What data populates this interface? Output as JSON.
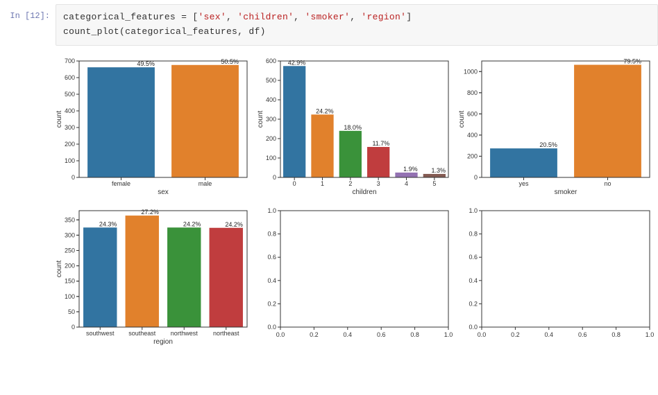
{
  "cell": {
    "prompt_label": "In [12]:",
    "code_name": "categorical_features",
    "code_assign": " = [",
    "code_str1": "'sex'",
    "code_sep": ", ",
    "code_str2": "'children'",
    "code_str3": "'smoker'",
    "code_str4": "'region'",
    "code_close": "]",
    "code_line2_fn": "count_plot",
    "code_line2_open": "(",
    "code_line2_arg1": "categorical_features",
    "code_line2_arg2": "df",
    "code_line2_close": ")"
  },
  "palette": [
    "#3274A1",
    "#E1812C",
    "#3A923A",
    "#C03D3E",
    "#9372B2",
    "#845B53"
  ],
  "chart_data": [
    {
      "type": "bar",
      "id": "sex",
      "xlabel": "sex",
      "ylabel": "count",
      "categories": [
        "female",
        "male"
      ],
      "values": [
        662,
        676
      ],
      "annotations": [
        "49.5%",
        "50.5%"
      ],
      "ylim": [
        0,
        700
      ],
      "yticks": [
        0,
        100,
        200,
        300,
        400,
        500,
        600,
        700
      ]
    },
    {
      "type": "bar",
      "id": "children",
      "xlabel": "children",
      "ylabel": "count",
      "categories": [
        "0",
        "1",
        "2",
        "3",
        "4",
        "5"
      ],
      "values": [
        574,
        324,
        240,
        157,
        25,
        18
      ],
      "annotations": [
        "42.9%",
        "24.2%",
        "18.0%",
        "11.7%",
        "1.9%",
        "1.3%"
      ],
      "ylim": [
        0,
        600
      ],
      "yticks": [
        0,
        100,
        200,
        300,
        400,
        500,
        600
      ]
    },
    {
      "type": "bar",
      "id": "smoker",
      "xlabel": "smoker",
      "ylabel": "count",
      "categories": [
        "yes",
        "no"
      ],
      "values": [
        274,
        1064
      ],
      "annotations": [
        "20.5%",
        "79.5%"
      ],
      "ylim": [
        0,
        1100
      ],
      "yticks": [
        0,
        200,
        400,
        600,
        800,
        1000
      ]
    },
    {
      "type": "bar",
      "id": "region",
      "xlabel": "region",
      "ylabel": "count",
      "categories": [
        "southwest",
        "southeast",
        "northwest",
        "northeast"
      ],
      "values": [
        325,
        364,
        325,
        324
      ],
      "annotations": [
        "24.3%",
        "27.2%",
        "24.2%",
        "24.2%"
      ],
      "ylim": [
        0,
        380
      ],
      "yticks": [
        0,
        50,
        100,
        150,
        200,
        250,
        300,
        350
      ]
    },
    {
      "type": "empty",
      "id": "empty1",
      "xlabel": "",
      "ylabel": "",
      "xticks": [
        0.0,
        0.2,
        0.4,
        0.6,
        0.8,
        1.0
      ],
      "yticks": [
        0.0,
        0.2,
        0.4,
        0.6,
        0.8,
        1.0
      ],
      "xlim": [
        0.0,
        1.0
      ],
      "ylim": [
        0.0,
        1.0
      ]
    },
    {
      "type": "empty",
      "id": "empty2",
      "xlabel": "",
      "ylabel": "",
      "xticks": [
        0.0,
        0.2,
        0.4,
        0.6,
        0.8,
        1.0
      ],
      "yticks": [
        0.0,
        0.2,
        0.4,
        0.6,
        0.8,
        1.0
      ],
      "xlim": [
        0.0,
        1.0
      ],
      "ylim": [
        0.0,
        1.0
      ]
    }
  ]
}
